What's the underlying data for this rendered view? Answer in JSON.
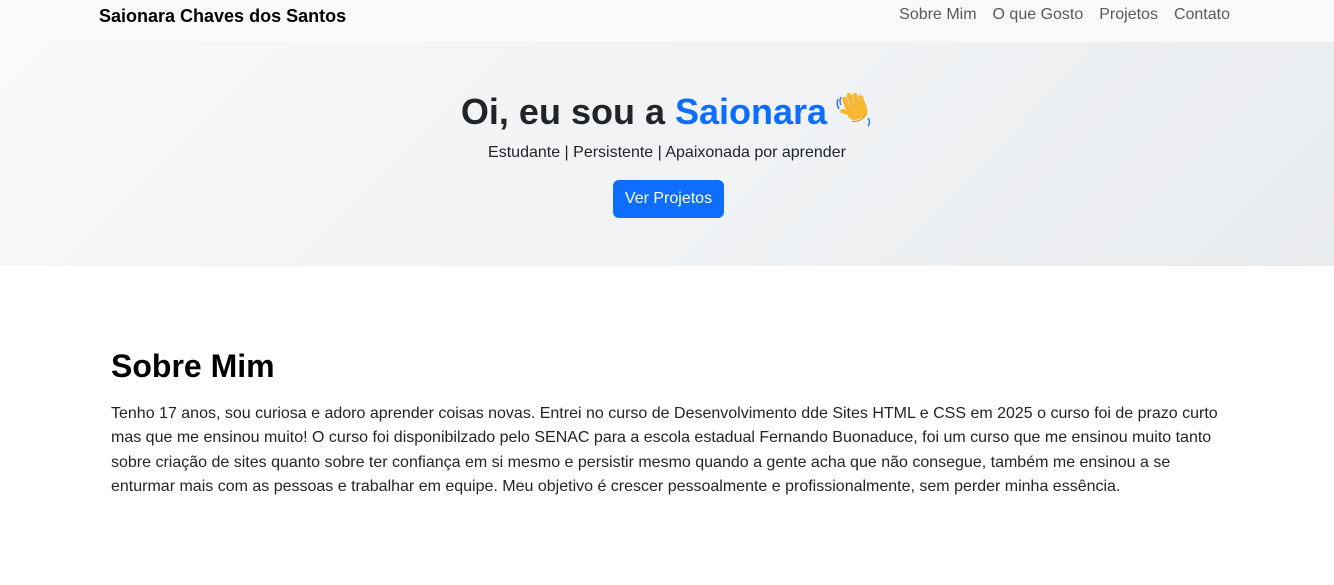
{
  "navbar": {
    "brand": "Saionara Chaves dos Santos",
    "links": [
      "Sobre Mim",
      "O que Gosto",
      "Projetos",
      "Contato"
    ]
  },
  "hero": {
    "title_prefix": "Oi, eu sou a",
    "title_name": "Saionara",
    "wave_icon": "waving-hand-icon",
    "subtitle": "Estudante | Persistente | Apaixonada por aprender",
    "button_label": "Ver Projetos"
  },
  "about": {
    "title": "Sobre Mim",
    "text": "Tenho 17 anos, sou curiosa e adoro aprender coisas novas. Entrei no curso de Desenvolvimento dde Sites HTML e CSS em 2025 o curso foi de prazo curto mas que me ensinou muito! O curso foi disponibilzado pelo SENAC para a escola estadual Fernando Buonaduce, foi um curso que me ensinou muito tanto sobre criação de sites quanto sobre ter confiança em si mesmo e persistir mesmo quando a gente acha que não consegue, também me ensinou a se enturmar mais com as pessoas e trabalhar em equipe. Meu objetivo é crescer pessoalmente e profissionalmente, sem perder minha essência."
  },
  "colors": {
    "accent": "#0d6efd",
    "navbar_bg": "#f8f9fa"
  }
}
